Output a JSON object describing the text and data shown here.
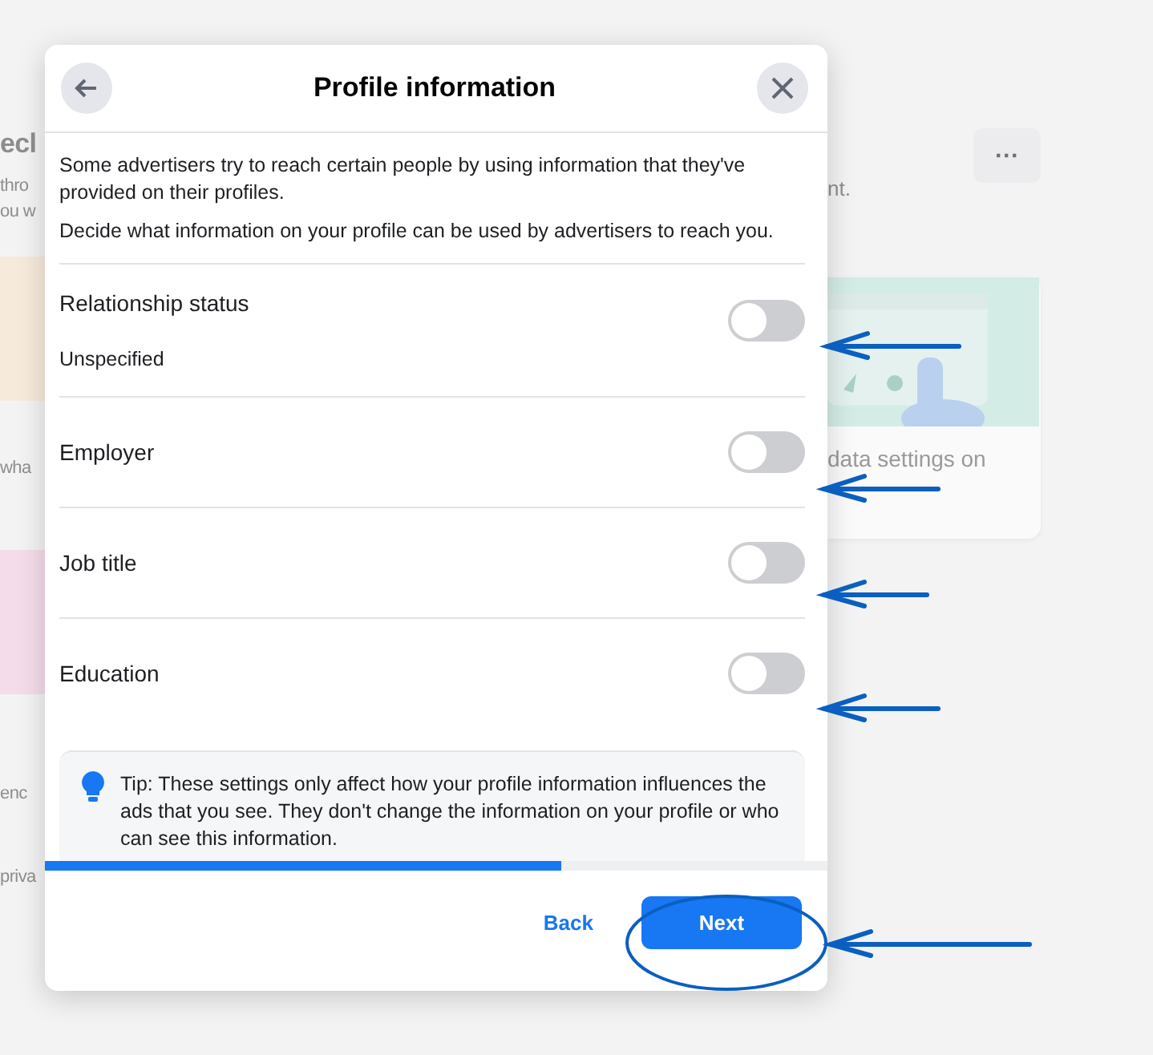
{
  "background": {
    "left_fragments": [
      "ecl",
      "thro",
      "ou w",
      "wha",
      "enc",
      "priva"
    ],
    "right_fragments": [
      "nt."
    ],
    "more_button": "···",
    "card_text": "data settings on"
  },
  "dialog": {
    "title": "Profile information",
    "intro": [
      "Some advertisers try to reach certain people by using information that they've provided on their profiles.",
      "Decide what information on your profile can be used by advertisers to reach you."
    ],
    "settings": [
      {
        "label": "Relationship status",
        "value": "Unspecified",
        "on": false
      },
      {
        "label": "Employer",
        "on": false
      },
      {
        "label": "Job title",
        "on": false
      },
      {
        "label": "Education",
        "on": false
      }
    ],
    "tip": "Tip: These settings only affect how your profile information influences the ads that you see. They don't change the information on your profile or who can see this information.",
    "progress": {
      "level": 0.66
    },
    "buttons": {
      "back": "Back",
      "next": "Next"
    }
  }
}
